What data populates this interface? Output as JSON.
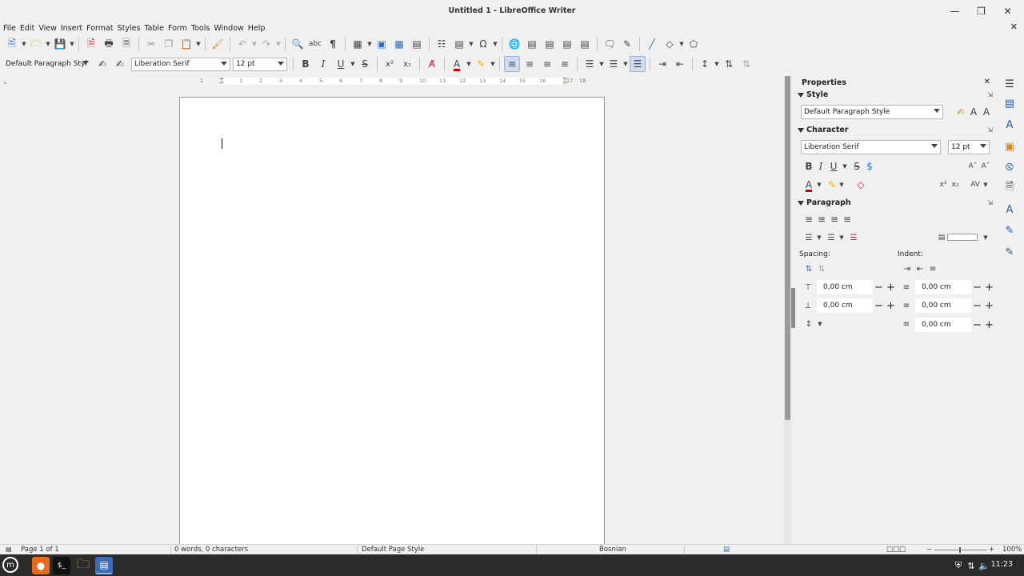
{
  "window": {
    "title": "Untitled 1 - LibreOffice Writer"
  },
  "menu": [
    "File",
    "Edit",
    "View",
    "Insert",
    "Format",
    "Styles",
    "Table",
    "Form",
    "Tools",
    "Window",
    "Help"
  ],
  "format_bar": {
    "paragraph_style": "Default Paragraph Styl",
    "font_name": "Liberation Serif",
    "font_size": "12 pt"
  },
  "ruler": {
    "labels": [
      "1",
      "1",
      "2",
      "3",
      "4",
      "5",
      "6",
      "7",
      "8",
      "9",
      "10",
      "11",
      "12",
      "13",
      "14",
      "15",
      "16",
      "17",
      "18"
    ]
  },
  "sidebar": {
    "title": "Properties",
    "style": {
      "header": "Style",
      "value": "Default Paragraph Style"
    },
    "character": {
      "header": "Character",
      "font": "Liberation Serif",
      "size": "12 pt"
    },
    "paragraph": {
      "header": "Paragraph",
      "spacing_label": "Spacing:",
      "indent_label": "Indent:",
      "above": "0,00 cm",
      "below": "0,00 cm",
      "before": "0,00 cm",
      "after": "0,00 cm",
      "first_line": "0,00 cm"
    }
  },
  "statusbar": {
    "page": "Page 1 of 1",
    "words": "0 words, 0 characters",
    "page_style": "Default Page Style",
    "language": "Bosnian",
    "zoom": "100%"
  },
  "taskbar": {
    "clock": "11:23"
  }
}
